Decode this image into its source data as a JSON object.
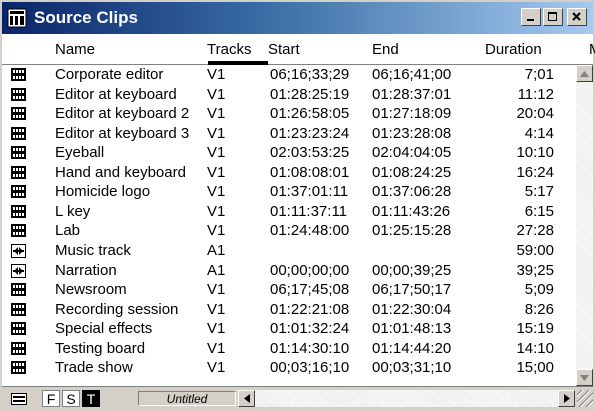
{
  "window": {
    "title": "Source Clips",
    "buttons": [
      "minimize-icon",
      "maximize-icon",
      "close-icon"
    ]
  },
  "columns": [
    "Name",
    "Tracks",
    "Start",
    "End",
    "Duration",
    "M"
  ],
  "rows": [
    {
      "icon": "video-clip-icon",
      "name": "Corporate editor",
      "tracks": "V1",
      "start": "06;16;33;29",
      "end": "06;16;41;00",
      "duration": "7;01"
    },
    {
      "icon": "video-clip-icon",
      "name": "Editor at keyboard",
      "tracks": "V1",
      "start": "01:28:25:19",
      "end": "01:28:37:01",
      "duration": "11:12"
    },
    {
      "icon": "video-clip-icon",
      "name": "Editor at keyboard 2",
      "tracks": "V1",
      "start": "01:26:58:05",
      "end": "01:27:18:09",
      "duration": "20:04"
    },
    {
      "icon": "video-clip-icon",
      "name": "Editor at keyboard 3",
      "tracks": "V1",
      "start": "01:23:23:24",
      "end": "01:23:28:08",
      "duration": "4:14"
    },
    {
      "icon": "video-clip-icon",
      "name": "Eyeball",
      "tracks": "V1",
      "start": "02:03:53:25",
      "end": "02:04:04:05",
      "duration": "10:10"
    },
    {
      "icon": "video-clip-icon",
      "name": "Hand and keyboard",
      "tracks": "V1",
      "start": "01:08:08:01",
      "end": "01:08:24:25",
      "duration": "16:24"
    },
    {
      "icon": "video-clip-icon",
      "name": "Homicide logo",
      "tracks": "V1",
      "start": "01:37:01:11",
      "end": "01:37:06:28",
      "duration": "5:17"
    },
    {
      "icon": "video-clip-icon",
      "name": "L key",
      "tracks": "V1",
      "start": "01:11:37:11",
      "end": "01:11:43:26",
      "duration": "6:15"
    },
    {
      "icon": "video-clip-icon",
      "name": "Lab",
      "tracks": "V1",
      "start": "01:24:48:00",
      "end": "01:25:15:28",
      "duration": "27:28"
    },
    {
      "icon": "audio-clip-icon",
      "name": "Music track",
      "tracks": "A1",
      "start": "",
      "end": "",
      "duration": "59:00"
    },
    {
      "icon": "audio-clip-icon",
      "name": "Narration",
      "tracks": "A1",
      "start": "00;00;00;00",
      "end": "00;00;39;25",
      "duration": "39;25"
    },
    {
      "icon": "video-clip-icon",
      "name": "Newsroom",
      "tracks": "V1",
      "start": "06;17;45;08",
      "end": "06;17;50;17",
      "duration": "5;09"
    },
    {
      "icon": "video-clip-icon",
      "name": "Recording session",
      "tracks": "V1",
      "start": "01:22:21:08",
      "end": "01:22:30:04",
      "duration": "8:26"
    },
    {
      "icon": "video-clip-icon",
      "name": "Special effects",
      "tracks": "V1",
      "start": "01:01:32:24",
      "end": "01:01:48:13",
      "duration": "15:19"
    },
    {
      "icon": "video-clip-icon",
      "name": "Testing board",
      "tracks": "V1",
      "start": "01:14:30:10",
      "end": "01:14:44:20",
      "duration": "14:10"
    },
    {
      "icon": "video-clip-icon",
      "name": "Trade show",
      "tracks": "V1",
      "start": "00;03;16;10",
      "end": "00;03;31;10",
      "duration": "15;00"
    }
  ],
  "bottom": {
    "views": [
      "F",
      "S",
      "T"
    ],
    "untitled_label": "Untitled"
  },
  "colors": {
    "title_start": "#0a246a",
    "title_end": "#a6caf0"
  }
}
